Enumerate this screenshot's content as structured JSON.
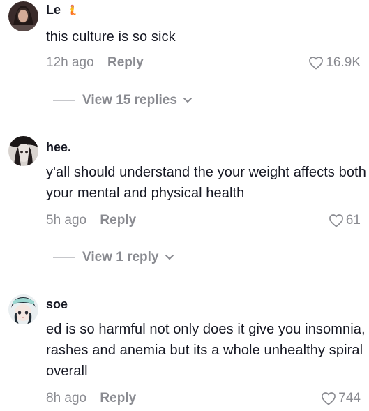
{
  "comments": [
    {
      "username": "Le",
      "badge": "🧜",
      "text": "this culture is so sick",
      "time": "12h ago",
      "reply_label": "Reply",
      "likes": "16.9K",
      "view_replies": "View 15 replies"
    },
    {
      "username": "hee.",
      "text": "y'all should understand the your weight affects both your mental and physical health",
      "time": "5h ago",
      "reply_label": "Reply",
      "likes": "61",
      "view_replies": "View 1 reply"
    },
    {
      "username": "soe",
      "text": "ed is so harmful not only does it give you insomnia, rashes and anemia but its a whole unhealthy spiral overall",
      "time": "8h ago",
      "reply_label": "Reply",
      "likes": "744"
    }
  ],
  "icons": {
    "like": "heart-outline-icon",
    "expand": "chevron-down-icon"
  },
  "colors": {
    "text": "#161823",
    "muted": "#8a8b91"
  }
}
